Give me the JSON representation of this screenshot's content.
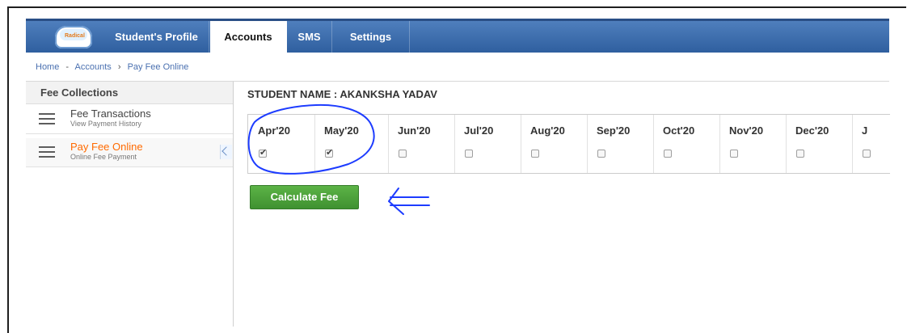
{
  "nav": {
    "logo_text": "Radical",
    "items": [
      "Student's Profile",
      "Accounts",
      "SMS",
      "Settings"
    ]
  },
  "breadcrumb": {
    "home": "Home",
    "accounts": "Accounts",
    "current": "Pay Fee Online",
    "sep1": "-",
    "sep2": "›"
  },
  "sidebar": {
    "header": "Fee Collections",
    "items": [
      {
        "title": "Fee Transactions",
        "subtitle": "View Payment History"
      },
      {
        "title": "Pay Fee Online",
        "subtitle": "Online Fee Payment"
      }
    ]
  },
  "main": {
    "student_name": "STUDENT NAME : AKANKSHA YADAV",
    "months": [
      "Apr'20",
      "May'20",
      "Jun'20",
      "Jul'20",
      "Aug'20",
      "Sep'20",
      "Oct'20",
      "Nov'20",
      "Dec'20",
      "J"
    ],
    "calculate_label": "Calculate Fee"
  },
  "colors": {
    "nav_blue": "#3566a8",
    "active_orange": "#ff6a00",
    "button_green": "#4ea53a",
    "annotation_blue": "#1d3cff"
  }
}
